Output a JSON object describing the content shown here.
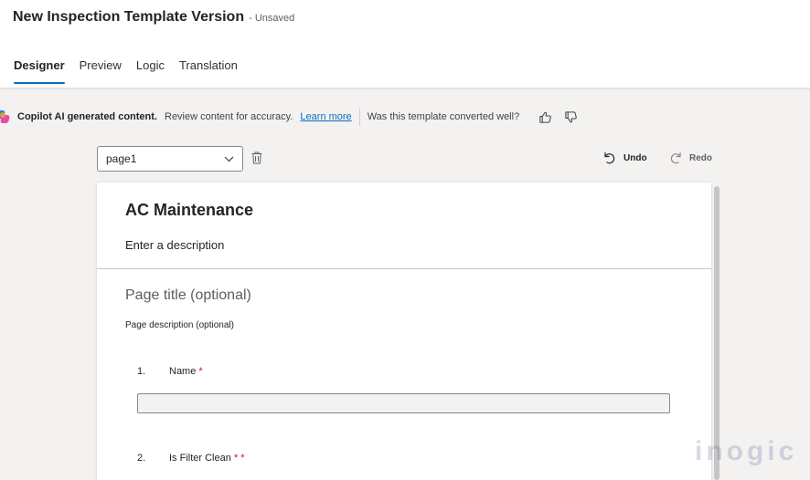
{
  "header": {
    "title": "New Inspection Template Version",
    "status": "- Unsaved",
    "tabs": [
      {
        "label": "Designer",
        "active": true
      },
      {
        "label": "Preview",
        "active": false
      },
      {
        "label": "Logic",
        "active": false
      },
      {
        "label": "Translation",
        "active": false
      }
    ]
  },
  "copilot": {
    "heading": "Copilot AI generated content.",
    "review_text": "Review content for accuracy.",
    "learn_more": "Learn more",
    "question": "Was this template converted well?"
  },
  "toolbar": {
    "page_select_value": "page1",
    "undo_label": "Undo",
    "redo_label": "Redo"
  },
  "form": {
    "title": "AC Maintenance",
    "description": "Enter a description",
    "page_title_placeholder": "Page title (optional)",
    "page_description_placeholder": "Page description (optional)",
    "questions": [
      {
        "number": "1.",
        "label": "Name",
        "required_marker": "*"
      },
      {
        "number": "2.",
        "label": "Is Filter Clean",
        "required_marker": "* *"
      }
    ]
  },
  "watermark": "inogic",
  "colors": {
    "accent": "#0f6cbd",
    "required": "#c50f1f",
    "background": "#f3f2f1"
  }
}
